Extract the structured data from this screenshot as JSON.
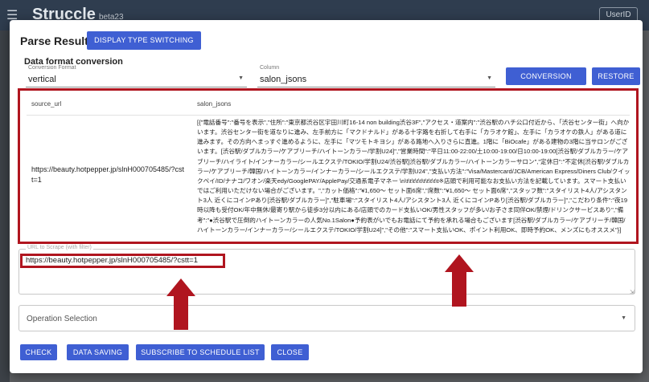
{
  "app": {
    "title": "Struccle",
    "version": "beta23",
    "user_button": "UserID"
  },
  "dialog": {
    "title": "Parse Result",
    "display_switch_label": "DISPLAY TYPE SWITCHING",
    "section_title": "Data format conversion",
    "format_select": {
      "label": "Conversion Format",
      "value": "vertical"
    },
    "column_select": {
      "label": "Column",
      "value": "salon_jsons"
    },
    "conversion_label": "CONVERSION",
    "restore_label": "RESTORE",
    "table": {
      "headers": [
        "source_url",
        "salon_jsons"
      ],
      "rows": [
        {
          "source_url": "https://beauty.hotpepper.jp/slnH000705485/?cstt=1",
          "salon_jsons": "[{\"電話番号\":\"番号を表示\",\"住所\":\"東京都渋谷区宇田川町16-14 non building渋谷3F\",\"アクセス・道案内\":\"渋谷駅のハチ公口付近から、「渋谷センター街」へ向かいます。渋谷センター街を道なりに進み、左手前方に「マクドナルド」がある十字路を右折して右手に「カラオケ館」、左手に「カラオケの鉄人」がある道に進みます。その方向へまっすぐ進めるように、左手に「マツモトキヨシ」がある路地へ入りさらに直進。1階に「BiOcafe」がある建物の3階に当サロンがございます。[渋谷駅/ダブルカラー/ケアブリーチ/ハイトーンカラー/学割U24]\",\"営業時間\":\"平日11:00-22:00/土10:00-19:00/日10:00-19:00[渋谷駅/ダブルカラー/ケアブリーチ/ハイライト/インナーカラー/シールエクステ/TOKIO/学割U24/渋谷駅]渋谷駅/ダブルカラー/ハイトーンカラーサロン\",\"定休日\":\"不定休[渋谷駅/ダブルカラー/ケアブリーチ/韓国/ハイトーンカラー/インナーカラー/シールエクステ/学割U24\",\"支払い方法\":\"Visa/Mastercard/JCB/American Express/Diners Club/クイックペイ/ID/ナナコ/ワオン/楽天edy/GooglePAY/ApplePay/交通系電子マネー \\n\\t\\t\\t\\t\\t\\t\\t\\t\\t\\t※店頭で利用可能なお支払い方法を記載しています。スマート支払いではご利用いただけない場合がございます。\",\"カット価格\":\"¥1,650～ セット面6席\",\"席数\":\"¥1,650～ セット面6席\",\"スタッフ数\":\"スタイリスト4人/アシスタント3人 近くにコインPあり[渋谷駅/ダブルカラー]\",\"駐車場\":\"スタイリスト4人/アシスタント3人 近くにコインPあり[渋谷駅/ダブルカラー]\",\"こだわり条件\":\"夜19時以降も受付OK/年中無休/最寄り駅から徒歩3分以内にある/店頭でのカード支払いOK/男性スタッフが多い/お子さま同伴OK/禁煙/ドリンクサービスあり\",\"備考\":\"●渋谷駅で圧倒的ハイトーンカラーの人気No.1Salon●予約表がいでもお電話にて予約を承れる場合もございます[渋谷駅/ダブルカラー/ケアブリーチ/韓国/ハイトーンカラー/インナーカラー/シールエクステ/TOKIO/学割U24]\",\"その他\":\"スマート支払いOK、ポイント利用OK、即時予約OK、メンズにもオススメ\"}]"
        }
      ]
    },
    "url_field": {
      "label": "URL to Scrape (with filter)",
      "value": "https://beauty.hotpepper.jp/slnH000705485/?cstt=1"
    },
    "operation_select": {
      "placeholder": "Operation Selection"
    },
    "actions": {
      "check": "CHECK",
      "data_saving": "DATA SAVING",
      "subscribe": "SUBSCRIBE TO SCHEDULE LIST",
      "close": "CLOSE"
    }
  },
  "colors": {
    "primary": "#3f5fd3",
    "highlight": "#b0151f",
    "appbar": "#2f3d4f"
  }
}
